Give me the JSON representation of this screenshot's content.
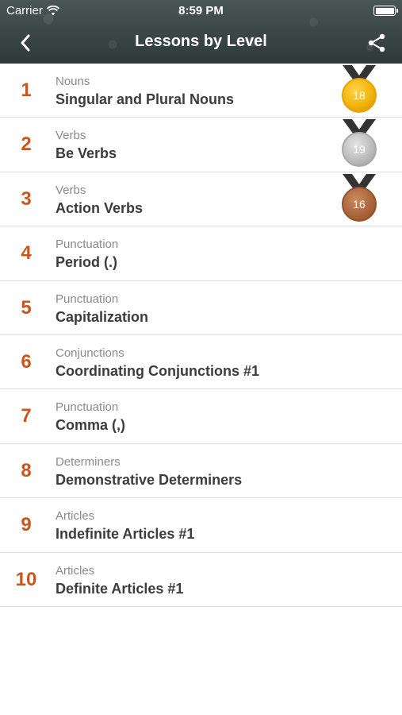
{
  "status_bar": {
    "carrier": "Carrier",
    "time": "8:59 PM",
    "icons": [
      "wifi-icon",
      "battery-icon"
    ]
  },
  "nav": {
    "title": "Lessons by Level",
    "back_icon": "chevron-left-icon",
    "share_icon": "share-icon"
  },
  "colors": {
    "accent": "#c9561c",
    "title_text": "#3c3c3c",
    "category_text": "#8a8a8a",
    "gold": "#f2b40c",
    "silver": "#bdbdbd",
    "bronze": "#a96339"
  },
  "lessons": [
    {
      "number": "1",
      "category": "Nouns",
      "title": "Singular and Plural Nouns",
      "medal": "gold",
      "medal_value": "18"
    },
    {
      "number": "2",
      "category": "Verbs",
      "title": "Be Verbs",
      "medal": "silver",
      "medal_value": "19"
    },
    {
      "number": "3",
      "category": "Verbs",
      "title": "Action Verbs",
      "medal": "bronze",
      "medal_value": "16"
    },
    {
      "number": "4",
      "category": "Punctuation",
      "title": "Period (.)"
    },
    {
      "number": "5",
      "category": "Punctuation",
      "title": "Capitalization"
    },
    {
      "number": "6",
      "category": "Conjunctions",
      "title": "Coordinating Conjunctions #1"
    },
    {
      "number": "7",
      "category": "Punctuation",
      "title": "Comma (,)"
    },
    {
      "number": "8",
      "category": "Determiners",
      "title": "Demonstrative Determiners"
    },
    {
      "number": "9",
      "category": "Articles",
      "title": "Indefinite Articles #1"
    },
    {
      "number": "10",
      "category": "Articles",
      "title": "Definite Articles #1"
    }
  ]
}
